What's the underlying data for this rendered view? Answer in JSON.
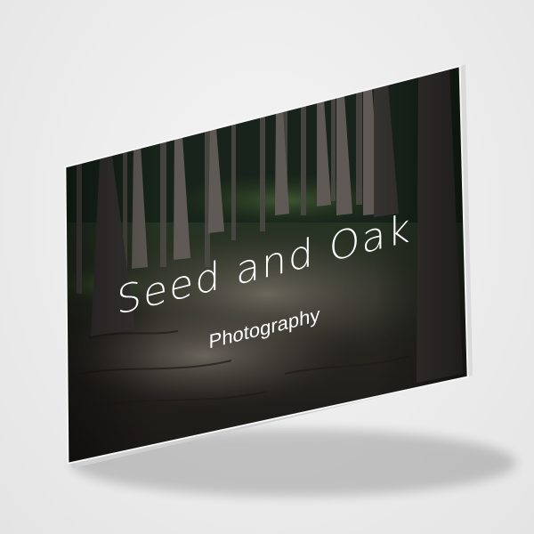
{
  "card": {
    "title": "Seed and Oak",
    "subtitle": "Photography"
  },
  "colors": {
    "background": "#ececec",
    "card_edge": "#f7f7f7",
    "forest_dark": "#141a17",
    "moss_green": "#3f5a34",
    "trunk": "#4b4743",
    "text": "#ffffff"
  }
}
